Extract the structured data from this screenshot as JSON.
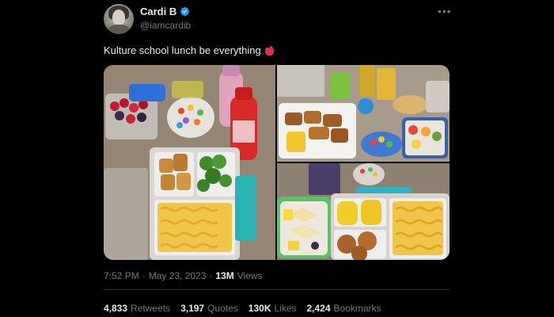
{
  "author": {
    "display_name": "Cardi B",
    "handle": "@iamcardib",
    "verified": true
  },
  "tweet": {
    "text": "Kulture school lunch be everything",
    "emoji": "red-apple-icon"
  },
  "media": {
    "count": 3,
    "photos": [
      {
        "description_icon": "lunchbox-photo-icon"
      },
      {
        "description_icon": "lunchbox-photo-icon"
      },
      {
        "description_icon": "lunchbox-photo-icon"
      }
    ]
  },
  "meta": {
    "time": "7:52 PM",
    "separator": "·",
    "date": "May 23, 2023",
    "views_count": "13M",
    "views_label": "Views"
  },
  "stats": {
    "retweets_count": "4,833",
    "retweets_label": "Retweets",
    "quotes_count": "3,197",
    "quotes_label": "Quotes",
    "likes_count": "130K",
    "likes_label": "Likes",
    "bookmarks_count": "2,424",
    "bookmarks_label": "Bookmarks"
  },
  "colors": {
    "background": "#000000",
    "text_primary": "#e7e9ea",
    "text_secondary": "#71767b",
    "verified_blue": "#1d9bf0",
    "divider": "#2f3336"
  }
}
